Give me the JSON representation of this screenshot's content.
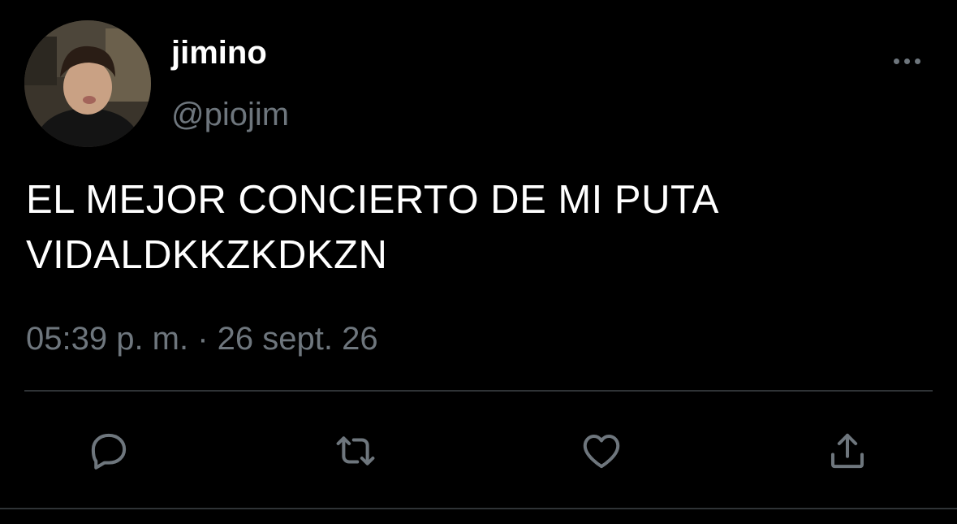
{
  "user": {
    "display_name": "jimino",
    "handle": "@piojim"
  },
  "tweet": {
    "text_line1": "EL MEJOR CONCIERTO DE MI PUTA",
    "text_line2": "VIDALDKKZKDKZN",
    "timestamp": "05:39 p. m. · 26 sept. 26"
  },
  "icons": {
    "more": "more-horizontal-icon",
    "reply": "comment-icon",
    "retweet": "retweet-icon",
    "like": "heart-icon",
    "share": "share-icon"
  },
  "colors": {
    "background": "#000000",
    "text_primary": "#ffffff",
    "text_secondary": "#6e767d",
    "divider": "#2f3336"
  }
}
